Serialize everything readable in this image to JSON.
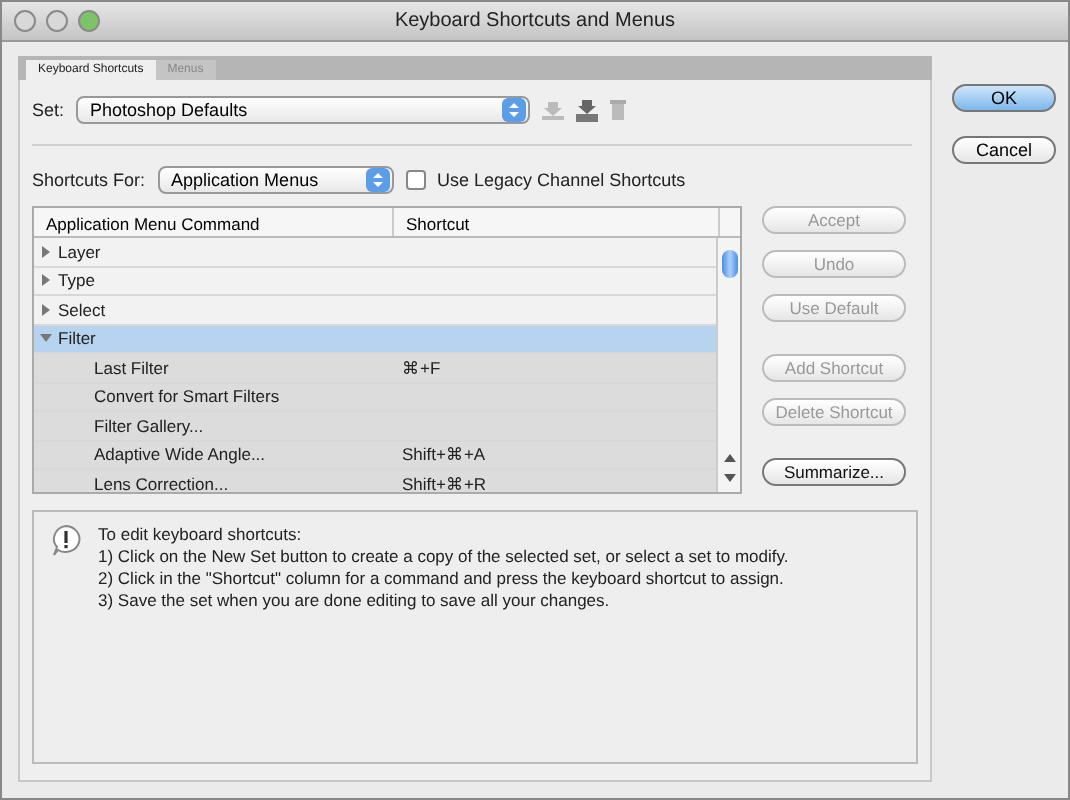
{
  "window": {
    "title": "Keyboard Shortcuts and Menus"
  },
  "tabs": [
    {
      "label": "Keyboard Shortcuts",
      "selected": true
    },
    {
      "label": "Menus",
      "selected": false
    }
  ],
  "set": {
    "label": "Set:",
    "value": "Photoshop Defaults"
  },
  "shortcuts_for": {
    "label": "Shortcuts For:",
    "value": "Application Menus"
  },
  "legacy_checkbox": {
    "label": "Use Legacy Channel Shortcuts",
    "checked": false
  },
  "table": {
    "columns": [
      "Application Menu Command",
      "Shortcut"
    ],
    "rows": [
      {
        "command": "Layer",
        "expanded": false,
        "selected": false,
        "children": []
      },
      {
        "command": "Type",
        "expanded": false,
        "selected": false,
        "children": []
      },
      {
        "command": "Select",
        "expanded": false,
        "selected": false,
        "children": []
      },
      {
        "command": "Filter",
        "expanded": true,
        "selected": true,
        "children": [
          {
            "command": "Last Filter",
            "shortcut": "⌘+F"
          },
          {
            "command": "Convert for Smart Filters"
          },
          {
            "command": "Filter Gallery..."
          },
          {
            "command": "Adaptive Wide Angle...",
            "shortcut": "Shift+⌘+A"
          },
          {
            "command": "Lens Correction...",
            "shortcut": "Shift+⌘+R"
          }
        ]
      }
    ]
  },
  "side_buttons": [
    {
      "label": "Accept",
      "disabled": true
    },
    {
      "label": "Undo",
      "disabled": true
    },
    {
      "label": "Use Default",
      "disabled": true
    },
    {
      "label": "Add Shortcut",
      "disabled": true
    },
    {
      "label": "Delete Shortcut",
      "disabled": true
    },
    {
      "label": "Summarize...",
      "disabled": false
    }
  ],
  "info": {
    "heading": "To edit keyboard shortcuts:",
    "steps": [
      "1) Click on the New Set button to create a copy of the selected set, or select a set to modify.",
      "2) Click in the \"Shortcut\" column for a command and press the keyboard shortcut to assign.",
      "3) Save the set when you are done editing to save all your changes."
    ]
  },
  "dialog_buttons": [
    {
      "label": "OK",
      "default": true
    },
    {
      "label": "Cancel",
      "default": false
    }
  ]
}
